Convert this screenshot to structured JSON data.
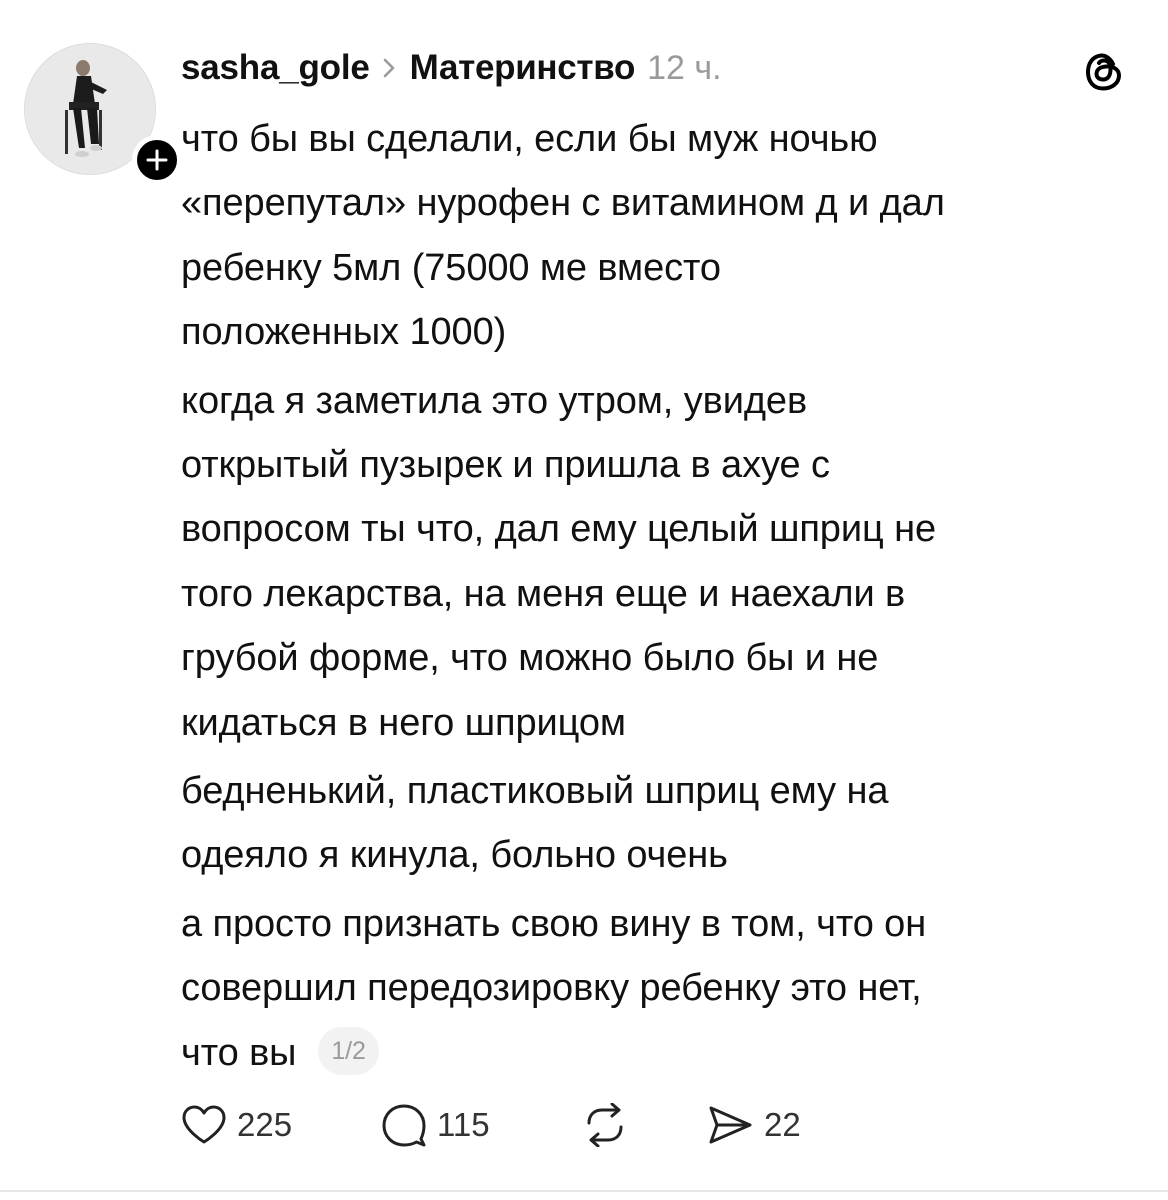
{
  "post": {
    "username": "sasha_gole",
    "community": "Материнство",
    "time": "12 ч.",
    "paragraphs": [
      {
        "lines": [
          "что бы вы сделали, если бы муж ночью",
          "«перепутал» нурофен с витамином д и дал",
          "ребенку 5мл (75000 ме вместо",
          "положенных 1000)"
        ]
      },
      {
        "lines": [
          "когда я заметила это утром, увидев",
          "открытый пузырек и пришла в ахуе с",
          "вопросом ты что, дал ему целый шприц не",
          "того лекарства, на меня еще и наехали в",
          "грубой форме, что можно было бы и не",
          "кидаться в него шприцом"
        ]
      },
      {
        "lines": [
          "бедненький, пластиковый шприц ему на",
          "одеяло я кинула, больно очень"
        ]
      },
      {
        "lines": [
          "а просто признать свою вину в том, что он",
          "совершил передозировку ребенку это нет,",
          "что вы"
        ]
      }
    ],
    "page_indicator": "1/2"
  },
  "actions": {
    "likes": "225",
    "replies": "115",
    "shares": "22"
  },
  "icons": {
    "follow": "plus-icon",
    "separator": "chevron-right-icon",
    "app": "threads-logo-icon",
    "like": "heart-icon",
    "reply": "comment-bubble-icon",
    "repost": "repost-icon",
    "share": "send-icon"
  },
  "colors": {
    "text": "#111111",
    "muted": "#9a9a9a",
    "badge": "#000000"
  }
}
